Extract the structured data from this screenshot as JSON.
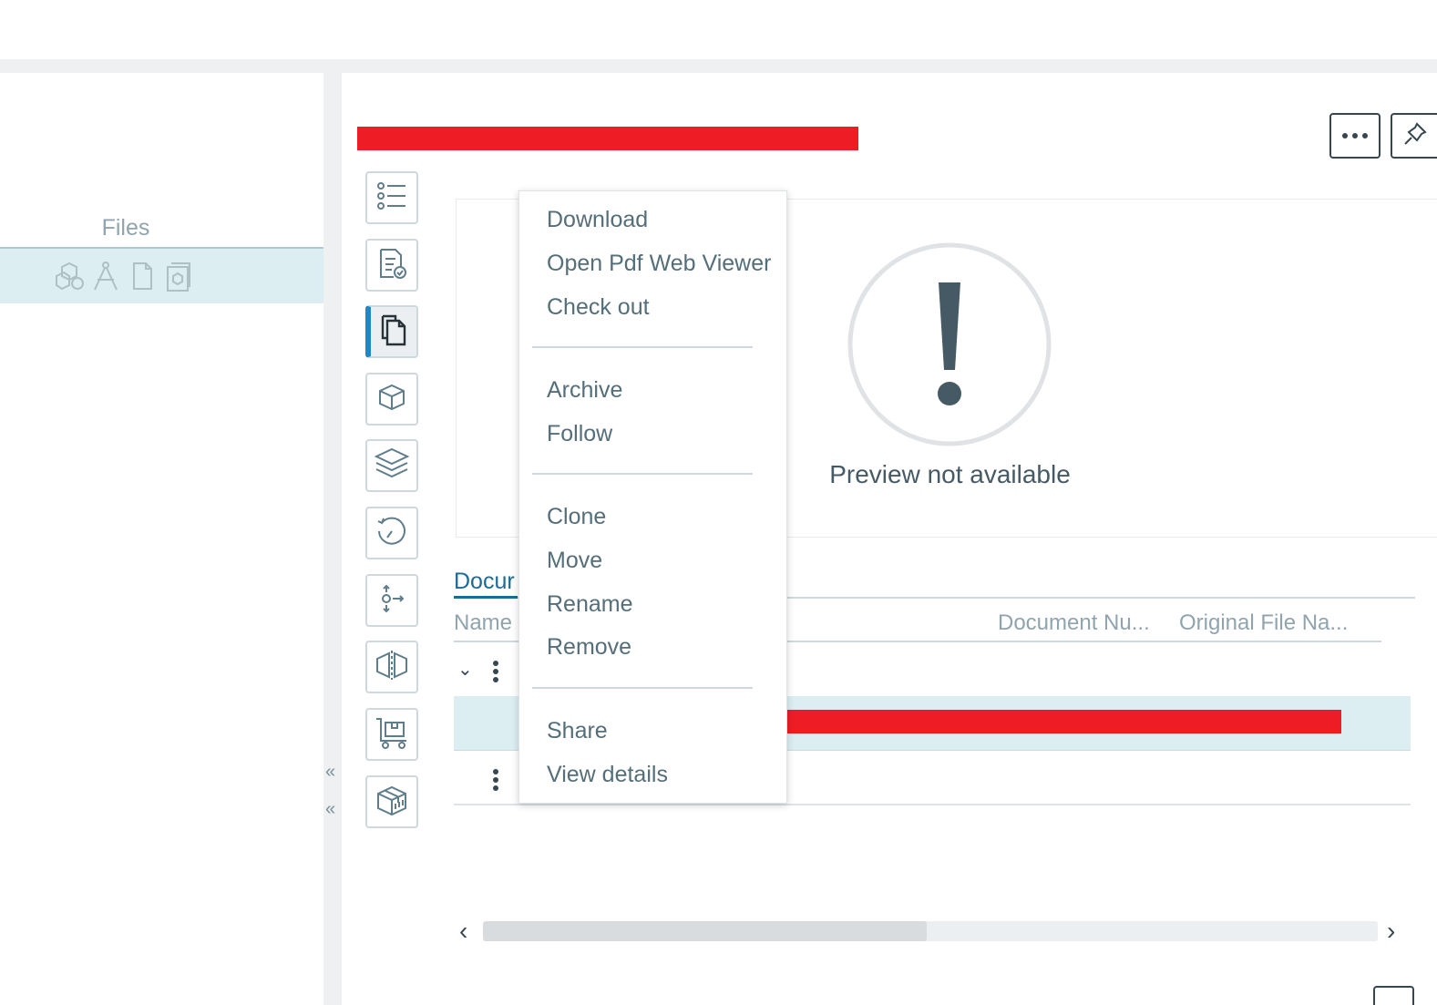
{
  "files_panel": {
    "title": "Files"
  },
  "preview": {
    "message": "Preview not available"
  },
  "documents": {
    "tab_label": "Docur",
    "columns": [
      "Name",
      "Document Nu...",
      "Original File Na..."
    ]
  },
  "context_menu": {
    "groups": [
      [
        "Download",
        "Open Pdf Web Viewer",
        "Check out"
      ],
      [
        "Archive",
        "Follow"
      ],
      [
        "Clone",
        "Move",
        "Rename",
        "Remove"
      ],
      [
        "Share",
        "View details"
      ]
    ]
  },
  "colors": {
    "accent": "#1e88c7",
    "redaction": "#ee1c25",
    "selection": "#dceef2"
  },
  "icons": [
    "more-icon",
    "pin-icon",
    "list-icon",
    "document-check-icon",
    "files-icon",
    "cube-icon",
    "layers-icon",
    "history-icon",
    "workflow-icon",
    "split-cube-icon",
    "cart-icon",
    "package-icon"
  ]
}
